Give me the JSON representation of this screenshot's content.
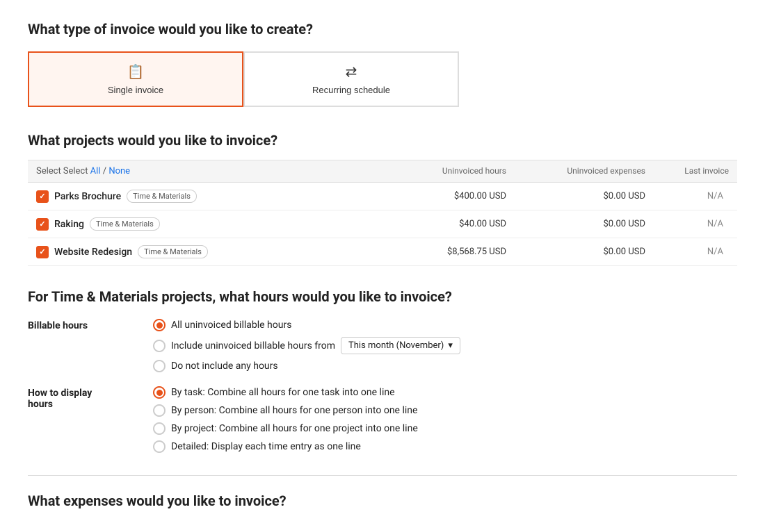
{
  "page": {
    "invoice_type_question": "What type of invoice would you like to create?",
    "projects_question": "What projects would you like to invoice?",
    "hours_question": "For Time & Materials projects, what hours would you like to invoice?",
    "expenses_question": "What expenses would you like to invoice?"
  },
  "invoice_types": [
    {
      "id": "single",
      "label": "Single invoice",
      "icon": "📋",
      "selected": true
    },
    {
      "id": "recurring",
      "label": "Recurring schedule",
      "icon": "🔁",
      "selected": false
    }
  ],
  "table": {
    "select_label": "Select",
    "all_label": "All",
    "none_label": "None",
    "separator": "/",
    "columns": {
      "project": "",
      "uninvoiced_hours": "Uninvoiced hours",
      "uninvoiced_expenses": "Uninvoiced expenses",
      "last_invoice": "Last invoice"
    },
    "rows": [
      {
        "checked": true,
        "name": "Parks Brochure",
        "tag": "Time & Materials",
        "uninvoiced_hours": "$400.00 USD",
        "uninvoiced_expenses": "$0.00 USD",
        "last_invoice": "N/A"
      },
      {
        "checked": true,
        "name": "Raking",
        "tag": "Time & Materials",
        "uninvoiced_hours": "$40.00 USD",
        "uninvoiced_expenses": "$0.00 USD",
        "last_invoice": "N/A"
      },
      {
        "checked": true,
        "name": "Website Redesign",
        "tag": "Time & Materials",
        "uninvoiced_hours": "$8,568.75 USD",
        "uninvoiced_expenses": "$0.00 USD",
        "last_invoice": "N/A"
      }
    ]
  },
  "billable_hours": {
    "label": "Billable hours",
    "options": [
      {
        "id": "all",
        "label": "All uninvoiced billable hours",
        "selected": true
      },
      {
        "id": "include",
        "label": "Include uninvoiced billable hours from",
        "selected": false
      },
      {
        "id": "none",
        "label": "Do not include any hours",
        "selected": false
      }
    ],
    "month_dropdown": "This month (November)"
  },
  "display_hours": {
    "label_line1": "How to display",
    "label_line2": "hours",
    "options": [
      {
        "id": "by_task",
        "label": "By task: Combine all hours for one task into one line",
        "selected": true
      },
      {
        "id": "by_person",
        "label": "By person: Combine all hours for one person into one line",
        "selected": false
      },
      {
        "id": "by_project",
        "label": "By project: Combine all hours for one project into one line",
        "selected": false
      },
      {
        "id": "detailed",
        "label": "Detailed: Display each time entry as one line",
        "selected": false
      }
    ]
  }
}
